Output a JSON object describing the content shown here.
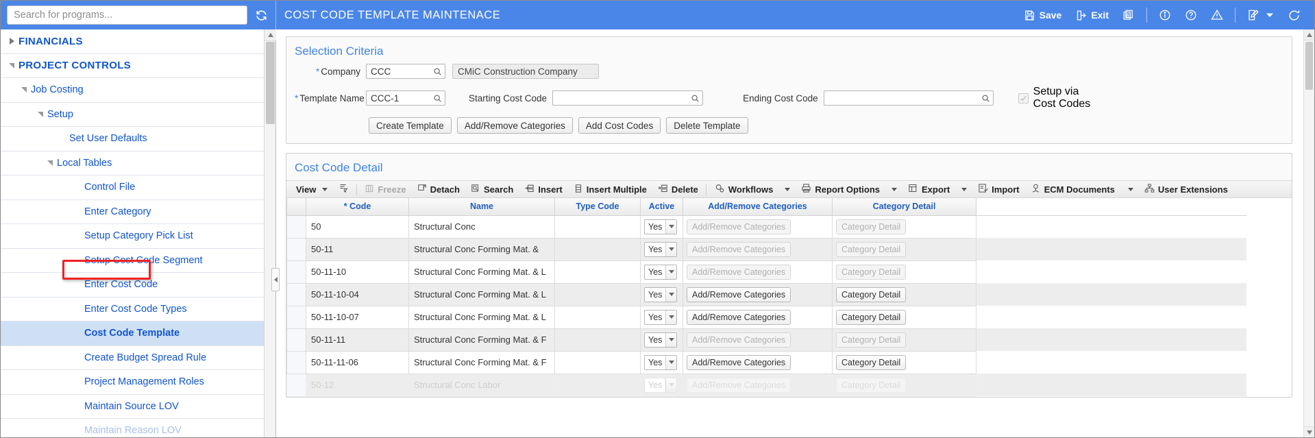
{
  "colors": {
    "brand_blue": "#4a86e8",
    "link_blue": "#1155cc",
    "panel_title": "#3f84e0",
    "annotation_red": "#ee2222",
    "selected_row": "#cfe0f5"
  },
  "sidebar": {
    "search": {
      "placeholder": "Search for programs...",
      "value": "",
      "refresh_icon": "refresh-icon"
    },
    "items": [
      {
        "label": "FINANCIALS",
        "level": 0,
        "state": "collapsed",
        "top": true
      },
      {
        "label": "PROJECT CONTROLS",
        "level": 0,
        "state": "expanded",
        "top": true
      },
      {
        "label": "Job Costing",
        "level": 1,
        "state": "expanded"
      },
      {
        "label": "Setup",
        "level": 2,
        "state": "expanded"
      },
      {
        "label": "Set User Defaults",
        "level": 3,
        "state": "leaf"
      },
      {
        "label": "Local Tables",
        "level": 3,
        "state": "expanded"
      },
      {
        "label": "Control File",
        "level": 4,
        "state": "leaf"
      },
      {
        "label": "Enter Category",
        "level": 4,
        "state": "leaf"
      },
      {
        "label": "Setup Category Pick List",
        "level": 4,
        "state": "leaf"
      },
      {
        "label": "Setup Cost Code Segment",
        "level": 4,
        "state": "leaf"
      },
      {
        "label": "Enter Cost Code",
        "level": 4,
        "state": "leaf"
      },
      {
        "label": "Enter Cost Code Types",
        "level": 4,
        "state": "leaf"
      },
      {
        "label": "Cost Code Template",
        "level": 4,
        "state": "leaf",
        "selected": true,
        "annotated": true
      },
      {
        "label": "Create Budget Spread Rule",
        "level": 4,
        "state": "leaf"
      },
      {
        "label": "Project Management Roles",
        "level": 4,
        "state": "leaf"
      },
      {
        "label": "Maintain Source LOV",
        "level": 4,
        "state": "leaf"
      },
      {
        "label": "Maintain Reason LOV",
        "level": 4,
        "state": "leaf",
        "faded": true
      }
    ]
  },
  "header": {
    "title": "COST CODE TEMPLATE MAINTENACE",
    "actions": [
      {
        "label": "Save",
        "icon": "save-icon"
      },
      {
        "label": "Exit",
        "icon": "exit-icon"
      },
      {
        "label": "",
        "icon": "copy-icon"
      },
      {
        "label": "",
        "icon": "info-icon"
      },
      {
        "label": "",
        "icon": "help-icon"
      },
      {
        "label": "",
        "icon": "warning-icon"
      },
      {
        "label": "",
        "icon": "edit-note-icon"
      },
      {
        "label": "",
        "icon": "refresh-icon"
      }
    ]
  },
  "selection_criteria": {
    "title": "Selection Criteria",
    "fields": {
      "company_label": "Company",
      "company_value": "CCC",
      "company_name": "CMiC Construction Company",
      "template_label": "Template Name",
      "template_value": "CCC-1",
      "starting_cost_code_label": "Starting Cost Code",
      "starting_cost_code_value": "",
      "ending_cost_code_label": "Ending Cost Code",
      "ending_cost_code_value": "",
      "setup_via_label_line1": "Setup via",
      "setup_via_label_line2": "Cost Codes",
      "setup_via_checked": true
    },
    "buttons": [
      "Create Template",
      "Add/Remove Categories",
      "Add Cost Codes",
      "Delete Template"
    ]
  },
  "cost_code_detail": {
    "title": "Cost Code Detail",
    "toolbar": [
      {
        "label": "View",
        "icon": "view-icon",
        "caret": true,
        "disabled": false
      },
      {
        "label": "",
        "icon": "query-filter-icon",
        "caret": false,
        "disabled": false
      },
      {
        "label": "Freeze",
        "icon": "freeze-icon",
        "caret": false,
        "disabled": true
      },
      {
        "label": "Detach",
        "icon": "detach-icon",
        "caret": false,
        "disabled": false
      },
      {
        "label": "Search",
        "icon": "search-icon",
        "caret": false,
        "disabled": false
      },
      {
        "label": "Insert",
        "icon": "insert-icon",
        "caret": false,
        "disabled": false
      },
      {
        "label": "Insert Multiple",
        "icon": "insert-multiple-icon",
        "caret": false,
        "disabled": false
      },
      {
        "label": "Delete",
        "icon": "delete-icon",
        "caret": false,
        "disabled": false
      },
      {
        "label": "Workflows",
        "icon": "workflows-icon",
        "caret": true,
        "disabled": false
      },
      {
        "label": "Report Options",
        "icon": "print-icon",
        "caret": true,
        "disabled": false
      },
      {
        "label": "Export",
        "icon": "export-icon",
        "caret": true,
        "disabled": false
      },
      {
        "label": "Import",
        "icon": "import-icon",
        "caret": false,
        "disabled": false
      },
      {
        "label": "ECM Documents",
        "icon": "ecm-icon",
        "caret": true,
        "disabled": false
      },
      {
        "label": "User Extensions",
        "icon": "user-extensions-icon",
        "caret": false,
        "disabled": false
      }
    ],
    "columns": [
      {
        "label": "* Code"
      },
      {
        "label": "Name"
      },
      {
        "label": "Type Code"
      },
      {
        "label": "Active"
      },
      {
        "label": "Add/Remove Categories"
      },
      {
        "label": "Category Detail"
      }
    ],
    "rows": [
      {
        "code": "50",
        "name": "Structural Conc",
        "type_code": "",
        "active": "Yes",
        "categories_btn": "Add/Remove Categories",
        "categories_enabled": false,
        "detail_btn": "Category Detail",
        "detail_enabled": false
      },
      {
        "code": "50-11",
        "name": "Structural Conc Forming Mat. &",
        "type_code": "",
        "active": "Yes",
        "categories_btn": "Add/Remove Categories",
        "categories_enabled": false,
        "detail_btn": "Category Detail",
        "detail_enabled": false
      },
      {
        "code": "50-11-10",
        "name": "Structural Conc Forming Mat. & L",
        "type_code": "",
        "active": "Yes",
        "categories_btn": "Add/Remove Categories",
        "categories_enabled": false,
        "detail_btn": "Category Detail",
        "detail_enabled": false
      },
      {
        "code": "50-11-10-04",
        "name": "Structural Conc Forming Mat. & L",
        "type_code": "",
        "active": "Yes",
        "categories_btn": "Add/Remove Categories",
        "categories_enabled": true,
        "detail_btn": "Category Detail",
        "detail_enabled": true
      },
      {
        "code": "50-11-10-07",
        "name": "Structural Conc Forming Mat. & L",
        "type_code": "",
        "active": "Yes",
        "categories_btn": "Add/Remove Categories",
        "categories_enabled": true,
        "detail_btn": "Category Detail",
        "detail_enabled": true
      },
      {
        "code": "50-11-11",
        "name": "Structural Conc Forming Mat. & F",
        "type_code": "",
        "active": "Yes",
        "categories_btn": "Add/Remove Categories",
        "categories_enabled": false,
        "detail_btn": "Category Detail",
        "detail_enabled": false
      },
      {
        "code": "50-11-11-06",
        "name": "Structural Conc Forming Mat. & F",
        "type_code": "",
        "active": "Yes",
        "categories_btn": "Add/Remove Categories",
        "categories_enabled": true,
        "detail_btn": "Category Detail",
        "detail_enabled": true
      },
      {
        "code": "50-12",
        "name": "Structural Conc Labor",
        "type_code": "",
        "active": "Yes",
        "categories_btn": "Add/Remove Categories",
        "categories_enabled": false,
        "detail_btn": "Category Detail",
        "detail_enabled": false,
        "clipped": true
      }
    ]
  }
}
